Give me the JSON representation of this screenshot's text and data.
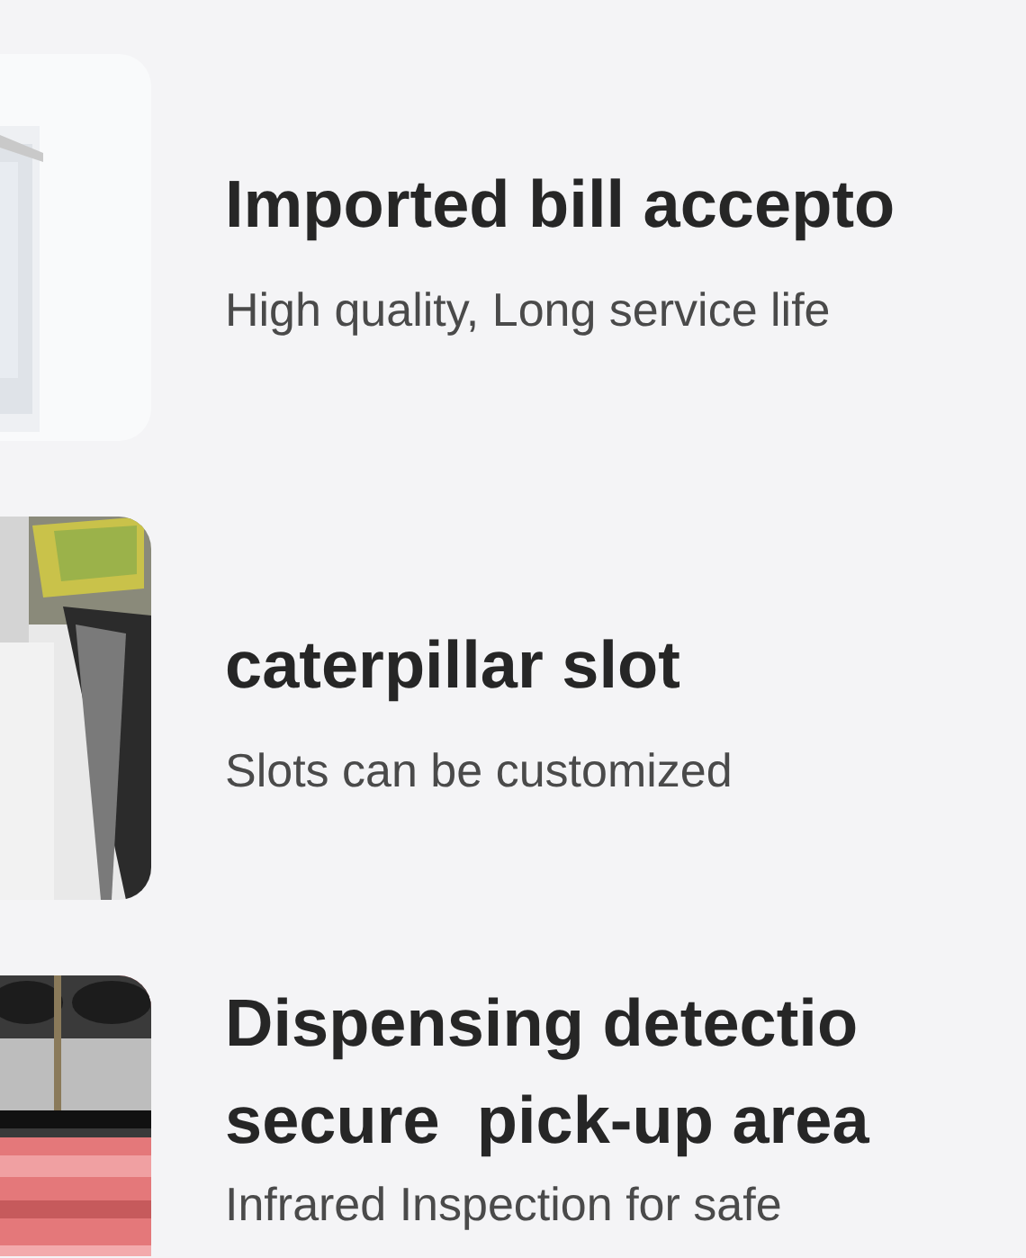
{
  "features": [
    {
      "image": {
        "kind": "picture"
      },
      "title_lines": [
        "Imported bill accepto"
      ],
      "subtitle": "High quality, Long service life"
    },
    {
      "image": {
        "kind": "picture"
      },
      "title_lines": [
        "caterpillar slot"
      ],
      "subtitle": "Slots can be customized"
    },
    {
      "image": {
        "kind": "picture"
      },
      "title_lines": [
        "Dispensing detectio",
        "secure  pick-up area"
      ],
      "subtitle": "Infrared Inspection for safe"
    }
  ]
}
